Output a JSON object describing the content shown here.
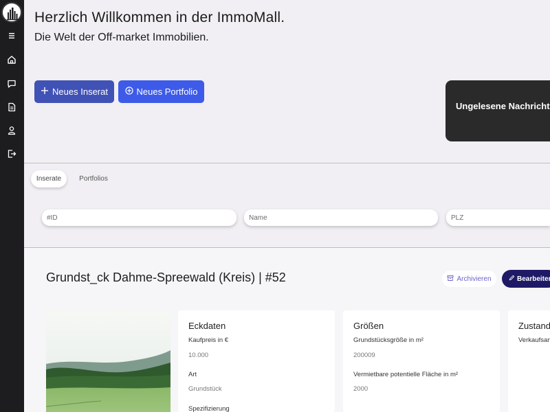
{
  "sidebar": {
    "items": [
      {
        "icon": "menu-icon"
      },
      {
        "icon": "home-icon"
      },
      {
        "icon": "chat-icon"
      },
      {
        "icon": "document-icon"
      },
      {
        "icon": "user-icon"
      },
      {
        "icon": "logout-icon"
      }
    ]
  },
  "header": {
    "title": "Herzlich Willkommen in der ImmoMall.",
    "subtitle": "Die Welt der Off-market Immobilien."
  },
  "actions": {
    "new_listing": "Neues Inserat",
    "new_portfolio": "Neues Portfolio"
  },
  "notifications": {
    "title": "Ungelesene Nachrichten"
  },
  "tabs": [
    {
      "label": "Inserate",
      "active": true
    },
    {
      "label": "Portfolios",
      "active": false
    }
  ],
  "filters": {
    "id_placeholder": "#ID",
    "name_placeholder": "Name",
    "plz_placeholder": "PLZ"
  },
  "listing": {
    "title": "Grundst_ck Dahme-Spreewald (Kreis) | #52",
    "archive_label": "Archivieren",
    "edit_label": "Bearbeiten",
    "cards": {
      "eckdaten": {
        "title": "Eckdaten",
        "kaufpreis_label": "Kaufpreis in €",
        "kaufpreis_value": "10.000",
        "art_label": "Art",
        "art_value": "Grundstück",
        "spezifizierung_label": "Spezifizierung"
      },
      "groessen": {
        "title": "Größen",
        "grundstueck_label": "Grundstücksgröße in m²",
        "grundstueck_value": "200009",
        "vermietbar_label": "Vermietbare potentielle Fläche in m²",
        "vermietbar_value": "2000"
      },
      "zustand": {
        "title": "Zustand",
        "verkauf_label": "Verkaufsart"
      }
    }
  },
  "colors": {
    "sidebar_bg": "#1d1d1f",
    "primary_button": "#4152b6",
    "secondary_button": "#3d5be8",
    "edit_button": "#1f1a66",
    "notification_bg": "#2a2a2a",
    "page_bg": "#f1eff3"
  }
}
